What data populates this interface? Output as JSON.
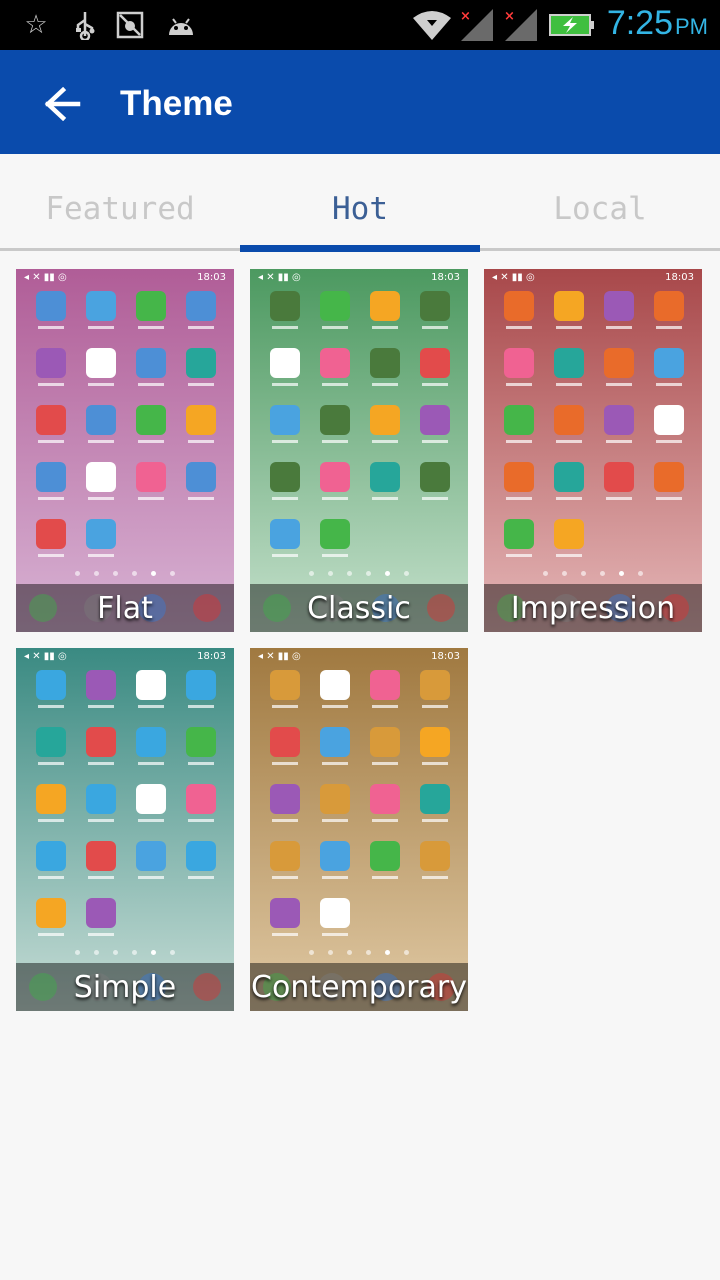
{
  "status_bar": {
    "time": "7:25",
    "ampm": "PM",
    "icons": [
      "star-icon",
      "usb-icon",
      "debug-icon",
      "android-icon",
      "wifi-icon",
      "signal-icon",
      "signal-icon",
      "battery-charging-icon"
    ]
  },
  "app_bar": {
    "title": "Theme",
    "back_icon": "arrow-back-icon"
  },
  "tabs": [
    {
      "label": "Featured",
      "active": false
    },
    {
      "label": "Hot",
      "active": true
    },
    {
      "label": "Local",
      "active": false
    }
  ],
  "themes": [
    {
      "name": "Flat",
      "bg_top": "#b05d97",
      "bg_bottom": "#d8b3d4",
      "icon_color": "#4d8fd6"
    },
    {
      "name": "Classic",
      "bg_top": "#4c9960",
      "bg_bottom": "#c5e0cc",
      "icon_color": "#4a7a3c"
    },
    {
      "name": "Impression",
      "bg_top": "#a8484a",
      "bg_bottom": "#e5b7b8",
      "icon_color": "#e96b2a"
    },
    {
      "name": "Simple",
      "bg_top": "#3a8a82",
      "bg_bottom": "#c7ddd6",
      "icon_color": "#3aa7e0"
    },
    {
      "name": "Contemporary",
      "bg_top": "#a07940",
      "bg_bottom": "#e0c9a4",
      "icon_color": "#d89a3a"
    }
  ],
  "mini_status_time": "18:03",
  "colors": {
    "app_bar": "#0a4bac",
    "tab_active": "#3b5f95",
    "tab_inactive": "#c8c8c8",
    "status_time": "#33b5e5"
  }
}
